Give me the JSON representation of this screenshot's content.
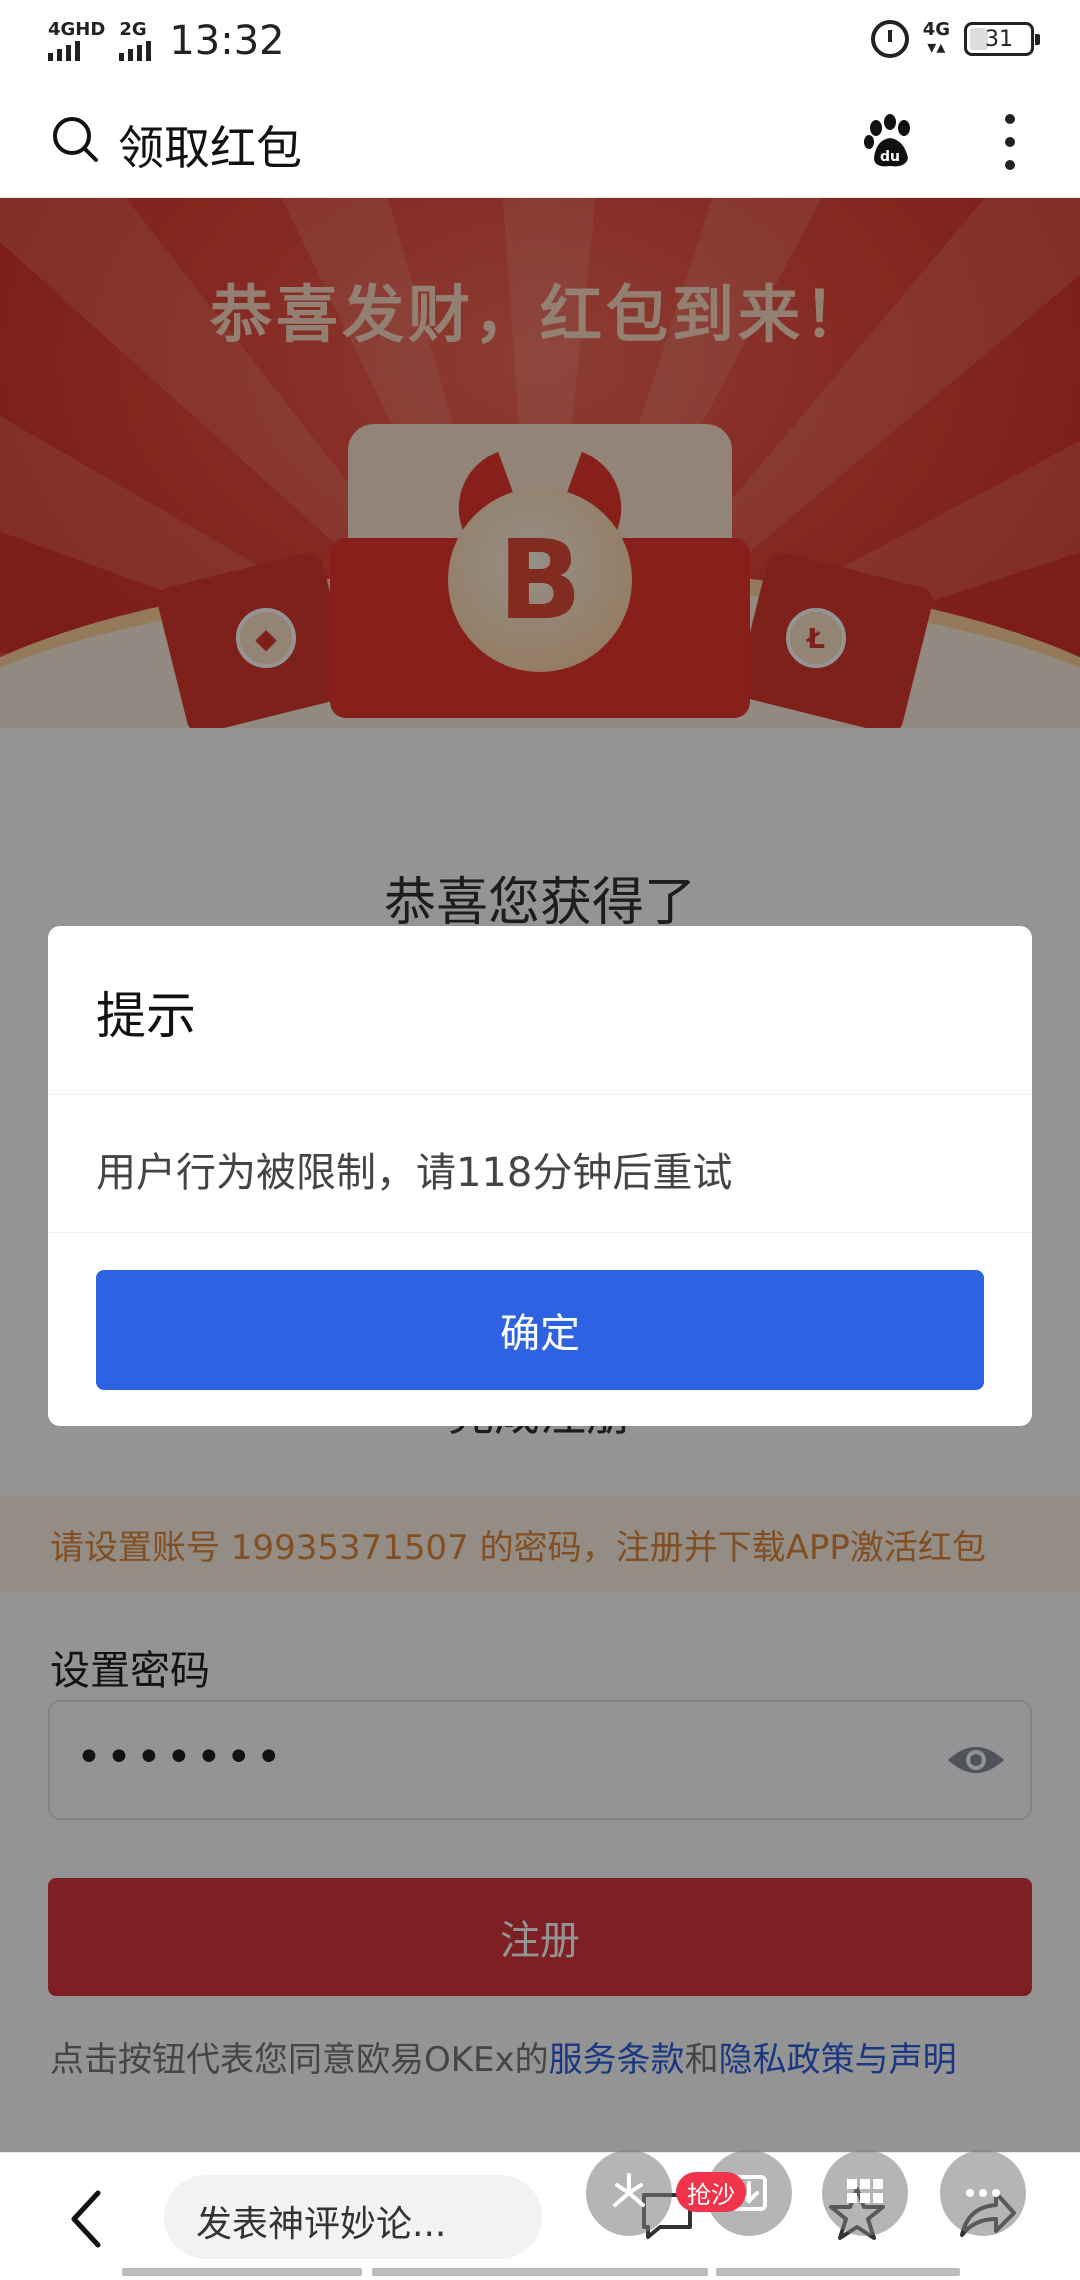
{
  "status_bar": {
    "sim1": "4GHD",
    "sim2": "2G",
    "time": "13:32",
    "network": "4G",
    "battery": "31"
  },
  "header": {
    "search_title": "领取红包",
    "icons": [
      "search-icon",
      "baidu-paw-icon",
      "more-vertical-icon"
    ]
  },
  "banner": {
    "title": "恭喜发财，红包到来！",
    "coin_symbol": "B"
  },
  "content": {
    "congrats": "恭喜您获得了",
    "form_heading": "完成注册",
    "notice": "请设置账号 19935371507 的密码，注册并下载APP激活红包",
    "password_label": "设置密码",
    "password_value": "•••••••",
    "register_button": "注册",
    "terms_prefix": "点击按钮代表您同意欧易OKEx的",
    "terms_link1": "服务条款",
    "terms_and": "和",
    "terms_link2": "隐私政策与声明"
  },
  "dialog": {
    "title": "提示",
    "message": "用户行为被限制，请118分钟后重试",
    "confirm": "确定"
  },
  "toolbar": {
    "comment_placeholder": "发表神评妙论...",
    "badge": "抢沙",
    "icons": [
      "back-icon",
      "comment-icon",
      "download-icon",
      "star-icon",
      "grid-icon",
      "share-icon",
      "more-icon"
    ]
  },
  "colors": {
    "dialog_button": "#2d62e3",
    "register_button": "#d9363e",
    "notice_text": "#e0883c",
    "link": "#2d5fe0",
    "banner_red": "#e64a3c"
  }
}
